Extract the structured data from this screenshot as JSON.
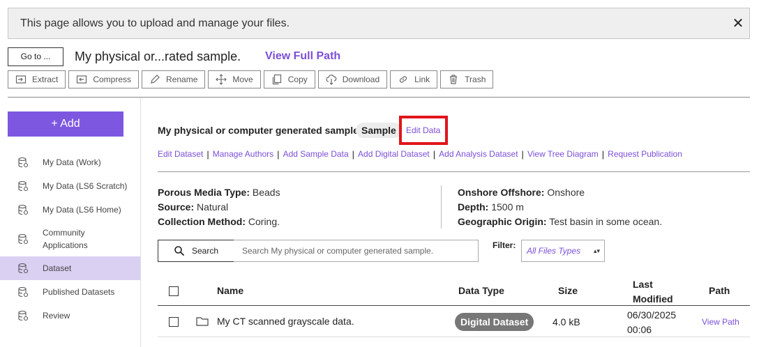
{
  "banner": {
    "message": "This page allows you to upload and manage your files.",
    "close_glyph": "✕"
  },
  "pathbar": {
    "goto_label": "Go to ...",
    "title": "My physical or...rated sample.",
    "full_path_label": "View Full Path"
  },
  "toolbar": {
    "buttons": [
      {
        "label": "Extract",
        "icon": "extract-icon"
      },
      {
        "label": "Compress",
        "icon": "compress-icon"
      },
      {
        "label": "Rename",
        "icon": "pencil-icon"
      },
      {
        "label": "Move",
        "icon": "move-arrows-icon"
      },
      {
        "label": "Copy",
        "icon": "copy-icon"
      },
      {
        "label": "Download",
        "icon": "cloud-download-icon"
      },
      {
        "label": "Link",
        "icon": "link-icon"
      },
      {
        "label": "Trash",
        "icon": "trash-icon"
      }
    ]
  },
  "sidebar": {
    "add_label": "+ Add",
    "items": [
      {
        "label": "My Data (Work)",
        "icon": "database-icon"
      },
      {
        "label": "My Data (LS6 Scratch)",
        "icon": "database-icon"
      },
      {
        "label": "My Data (LS6 Home)",
        "icon": "database-icon"
      },
      {
        "label": "Community Applications",
        "icon": "database-icon"
      },
      {
        "label": "Dataset",
        "icon": "database-icon"
      },
      {
        "label": "Published Datasets",
        "icon": "database-icon"
      },
      {
        "label": "Review",
        "icon": "database-icon"
      }
    ],
    "active_index": 4
  },
  "dataset": {
    "title": "My physical or computer generated sample.",
    "badge": "Sample",
    "edit_label": "Edit Data",
    "actions": [
      "Edit Dataset",
      "Manage Authors",
      "Add Sample Data",
      "Add Digital Dataset",
      "Add Analysis Dataset",
      "View Tree Diagram",
      "Request Publication"
    ],
    "actions_separator": "|",
    "meta_left": [
      {
        "key": "Porous Media Type:",
        "value": "Beads"
      },
      {
        "key": "Source:",
        "value": "Natural"
      },
      {
        "key": "Collection Method:",
        "value": "Coring."
      }
    ],
    "meta_right": [
      {
        "key": "Onshore Offshore:",
        "value": "Onshore"
      },
      {
        "key": "Depth:",
        "value": "1500 m"
      },
      {
        "key": "Geographic Origin:",
        "value": "Test basin in some ocean."
      }
    ]
  },
  "search": {
    "button_label": "Search",
    "placeholder": "Search My physical or computer generated sample.",
    "filter_label": "Filter:",
    "filter_value": "All Files Types",
    "filter_caret": "▴▾"
  },
  "table": {
    "headers": {
      "name": "Name",
      "data_type": "Data Type",
      "size": "Size",
      "last_modified_1": "Last",
      "last_modified_2": "Modified",
      "path": "Path"
    },
    "rows": [
      {
        "name": "My CT scanned grayscale data.",
        "data_type": "Digital Dataset",
        "size": "4.0 kB",
        "date": "06/30/2025",
        "time": "00:06",
        "path_label": "View Path"
      }
    ]
  },
  "colors": {
    "accent": "#7e57e1",
    "link": "#7b4fd8",
    "highlight_box": "#e0151b",
    "active_nav": "#d9d0f2"
  }
}
